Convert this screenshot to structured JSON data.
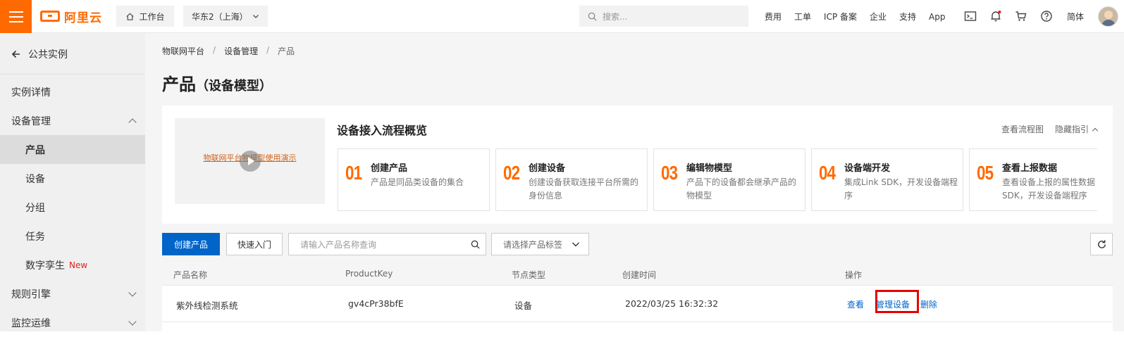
{
  "topbar": {
    "logo_text": "阿里云",
    "workspace": "工作台",
    "region": "华东2（上海）",
    "search_placeholder": "搜索...",
    "links": [
      "费用",
      "工单",
      "ICP 备案",
      "企业",
      "支持",
      "App"
    ],
    "lang": "简体",
    "icons": [
      "terminal-icon",
      "bell-icon",
      "cart-icon",
      "help-icon"
    ],
    "brand_color": "#ff6a00"
  },
  "sidebar": {
    "back_label": "公共实例",
    "instance_detail": "实例详情",
    "device_mgmt": "设备管理",
    "sub_items": [
      "产品",
      "设备",
      "分组",
      "任务",
      "数字孪生"
    ],
    "new_tag": "New",
    "rules_engine": "规则引擎",
    "monitoring": "监控运维"
  },
  "breadcrumb": [
    "物联网平台",
    "设备管理",
    "产品"
  ],
  "page": {
    "title": "产品",
    "title_suffix": "（设备模型）"
  },
  "guide": {
    "video_title": "物联网平台物模型使用演示",
    "flow_title": "设备接入流程概览",
    "view_flowchart": "查看流程图",
    "hide_guide": "隐藏指引",
    "steps": [
      {
        "num": "01",
        "name": "创建产品",
        "desc": "产品是同品类设备的集合"
      },
      {
        "num": "02",
        "name": "创建设备",
        "desc": "创建设备获取连接平台所需的身份信息"
      },
      {
        "num": "03",
        "name": "编辑物模型",
        "desc": "产品下的设备都会继承产品的物模型"
      },
      {
        "num": "04",
        "name": "设备端开发",
        "desc": "集成Link SDK，开发设备端程序"
      },
      {
        "num": "05",
        "name": "查看上报数据",
        "desc": "查看设备上报的属性数据SDK，开发设备端程序"
      }
    ]
  },
  "toolbar": {
    "create_product": "创建产品",
    "quick_start": "快速入门",
    "search_placeholder": "请输入产品名称查询",
    "tag_placeholder": "请选择产品标签"
  },
  "table": {
    "columns": [
      "产品名称",
      "ProductKey",
      "节点类型",
      "创建时间",
      "操作"
    ],
    "rows": [
      {
        "name": "紫外线检测系统",
        "product_key": "gv4cPr38bfE",
        "node_type": "设备",
        "created": "2022/03/25 16:32:32",
        "actions": [
          "查看",
          "管理设备",
          "删除"
        ]
      }
    ],
    "link_color": "#0064c8"
  }
}
